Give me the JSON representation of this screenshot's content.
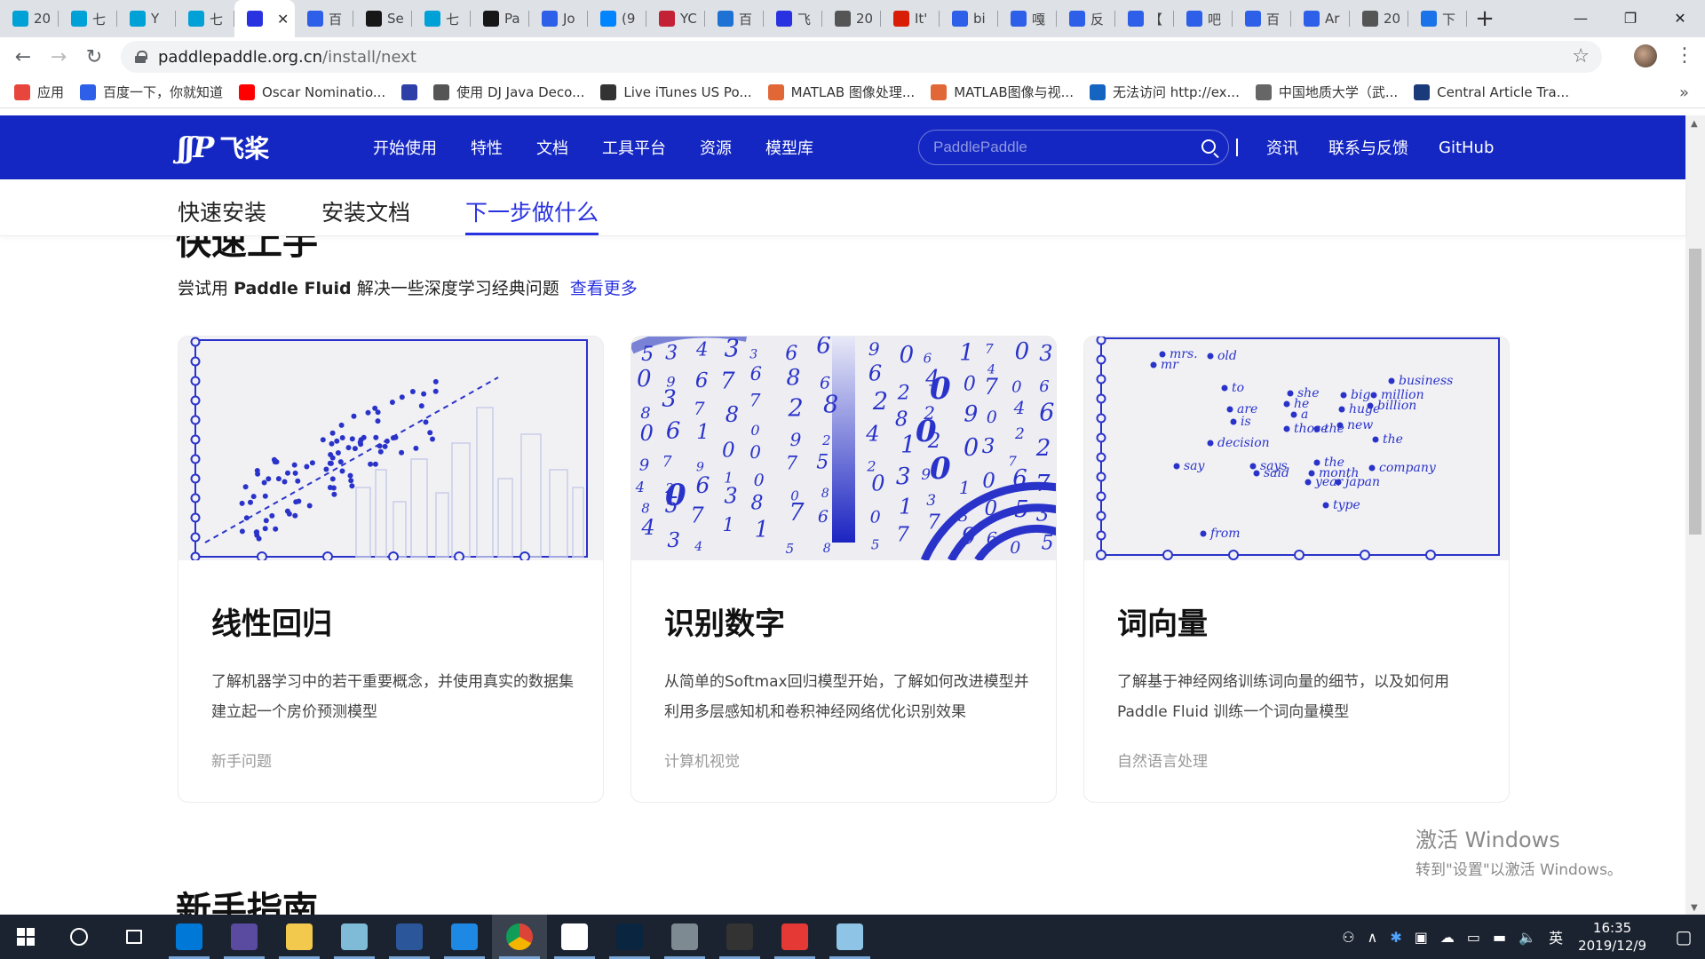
{
  "browser": {
    "tabs": [
      {
        "label": "20",
        "icon": "bilibili-icon",
        "color": "#00a1d6"
      },
      {
        "label": "七",
        "icon": "bilibili-icon",
        "color": "#00a1d6"
      },
      {
        "label": "Y",
        "icon": "bilibili-icon",
        "color": "#00a1d6"
      },
      {
        "label": "七",
        "icon": "bilibili-icon",
        "color": "#00a1d6"
      },
      {
        "label": "",
        "icon": "paddle-icon",
        "color": "#2932e1",
        "active": true
      },
      {
        "label": "百",
        "icon": "baidu-paw-icon",
        "color": "#2e5fe8"
      },
      {
        "label": "Se",
        "icon": "github-icon",
        "color": "#181717"
      },
      {
        "label": "七",
        "icon": "bilibili-icon",
        "color": "#00a1d6"
      },
      {
        "label": "Pa",
        "icon": "github-icon",
        "color": "#181717"
      },
      {
        "label": "Jo",
        "icon": "baidu-paw-icon",
        "color": "#2e5fe8"
      },
      {
        "label": "(9",
        "icon": "zhihu-icon",
        "color": "#0084ff"
      },
      {
        "label": "YC",
        "icon": "csdn-icon",
        "color": "#c32136"
      },
      {
        "label": "百",
        "icon": "fanyi-icon",
        "color": "#1d72d4"
      },
      {
        "label": "飞",
        "icon": "paddle-icon",
        "color": "#2932e1"
      },
      {
        "label": "20",
        "icon": "aminer-icon",
        "color": "#555555"
      },
      {
        "label": "It'",
        "icon": "target-icon",
        "color": "#d81e06"
      },
      {
        "label": "bi",
        "icon": "baidu-paw-icon",
        "color": "#2e5fe8"
      },
      {
        "label": "嘎",
        "icon": "baidu-paw-icon",
        "color": "#2e5fe8"
      },
      {
        "label": "反",
        "icon": "baidu-paw-icon",
        "color": "#2e5fe8"
      },
      {
        "label": "【",
        "icon": "baidu-paw-icon",
        "color": "#2e5fe8"
      },
      {
        "label": "吧",
        "icon": "baidu-paw-icon",
        "color": "#2e5fe8"
      },
      {
        "label": "百",
        "icon": "baidu-paw-icon",
        "color": "#2e5fe8"
      },
      {
        "label": "Ar",
        "icon": "baidu-paw-icon",
        "color": "#2e5fe8"
      },
      {
        "label": "20",
        "icon": "aminer-icon",
        "color": "#555555"
      },
      {
        "label": "下",
        "icon": "download-icon",
        "color": "#1a73e8"
      }
    ],
    "new_tab": "+",
    "window_controls": {
      "minimize": "—",
      "restore": "❐",
      "close": "✕"
    },
    "nav": {
      "back": "←",
      "forward": "→",
      "reload": "↻"
    },
    "address": {
      "host": "paddlepaddle.org.cn",
      "path": "/install/next"
    },
    "bookmark_star": "☆",
    "menu": "⋮",
    "bookmarks": [
      {
        "label": "应用",
        "icon": "apps-grid-icon",
        "color": "#e8453c"
      },
      {
        "label": "百度一下，你就知道",
        "icon": "baidu-paw-icon",
        "color": "#2e5fe8"
      },
      {
        "label": "Oscar Nominatio...",
        "icon": "youtube-icon",
        "color": "#ff0000"
      },
      {
        "label": "",
        "icon": "baidu-image-icon",
        "color": "#2e3fa8"
      },
      {
        "label": "使用 DJ Java Deco...",
        "icon": "aminer-icon",
        "color": "#555555"
      },
      {
        "label": "Live iTunes US Po...",
        "icon": "chart-bars-icon",
        "color": "#333333"
      },
      {
        "label": "MATLAB 图像处理...",
        "icon": "matlab-icon",
        "color": "#e16737"
      },
      {
        "label": "MATLAB图像与视...",
        "icon": "matlab-icon",
        "color": "#e16737"
      },
      {
        "label": "无法访问 http://ex...",
        "icon": "box-icon",
        "color": "#1565c0"
      },
      {
        "label": "中国地质大学（武...",
        "icon": "globe-icon",
        "color": "#666666"
      },
      {
        "label": "Central Article Tra...",
        "icon": "cat-icon",
        "color": "#1a3a7a"
      }
    ],
    "bookmarks_more": "»"
  },
  "site": {
    "logo_mark": "ʃʃP",
    "logo_text": "飞桨",
    "nav_links": [
      "开始使用",
      "特性",
      "文档",
      "工具平台",
      "资源",
      "模型库"
    ],
    "search_placeholder": "PaddlePaddle",
    "nav_right": [
      "资讯",
      "联系与反馈",
      "GitHub"
    ],
    "brand_color": "#1527c2",
    "accent_color": "#2932e1"
  },
  "subnav": {
    "items": [
      "快速安装",
      "安装文档",
      "下一步做什么"
    ],
    "active_index": 2
  },
  "section": {
    "title": "快速上手",
    "subtitle_prefix": "尝试用",
    "subtitle_bold": "Paddle Fluid",
    "subtitle_suffix": "解决一些深度学习经典问题",
    "more_link": "查看更多"
  },
  "cards": [
    {
      "title": "线性回归",
      "desc": "了解机器学习中的若干重要概念，并使用真实的数据集建立起一个房价预测模型",
      "tag": "新手问题",
      "image": "linear-regression-illustration"
    },
    {
      "title": "识别数字",
      "desc": "从简单的Softmax回归模型开始，了解如何改进模型并利用多层感知机和卷积神经网络优化识别效果",
      "tag": "计算机视觉",
      "image": "digits-illustration"
    },
    {
      "title": "词向量",
      "desc": "了解基于神经网络训练词向量的细节，以及如何用 Paddle Fluid 训练一个词向量模型",
      "tag": "自然语言处理",
      "image": "word-vector-illustration",
      "words": [
        "mrs.",
        "mr",
        "old",
        "to",
        "are",
        "is",
        "she",
        "he",
        "a",
        "those",
        "the",
        "big",
        "huge",
        "billion",
        "million",
        "business",
        "new",
        "the",
        "decision",
        "say",
        "says",
        "said",
        "the",
        "month",
        "year",
        "japan",
        "company",
        "type",
        "from"
      ]
    }
  ],
  "next_section": {
    "title": "新手指南"
  },
  "watermark": {
    "line1": "激活 Windows",
    "line2": "转到\"设置\"以激活 Windows。"
  },
  "taskbar": {
    "apps": [
      {
        "name": "search-circle-icon",
        "color": "transparent"
      },
      {
        "name": "task-view-icon",
        "color": "transparent"
      },
      {
        "name": "edge-icon",
        "color": "#0078d7"
      },
      {
        "name": "vr-headset-icon",
        "color": "#5a4aa0"
      },
      {
        "name": "file-explorer-icon",
        "color": "#f2c94c"
      },
      {
        "name": "eraser-icon",
        "color": "#7fbad6"
      },
      {
        "name": "word-icon",
        "color": "#2b579a"
      },
      {
        "name": "app-5-icon",
        "color": "#1e88e5"
      },
      {
        "name": "chrome-icon",
        "color": "#4caf50",
        "active": true
      },
      {
        "name": "clapper-icon",
        "color": "#ffffff"
      },
      {
        "name": "photoshop-icon",
        "color": "#0a2540"
      },
      {
        "name": "drive-icon",
        "color": "#7d8a92"
      },
      {
        "name": "music-disc-icon",
        "color": "#333333"
      },
      {
        "name": "g-icon",
        "color": "#e53935"
      },
      {
        "name": "sticker-icon",
        "color": "#8ec5e6"
      }
    ],
    "ime": "英",
    "time": "16:35",
    "date": "2019/12/9"
  }
}
